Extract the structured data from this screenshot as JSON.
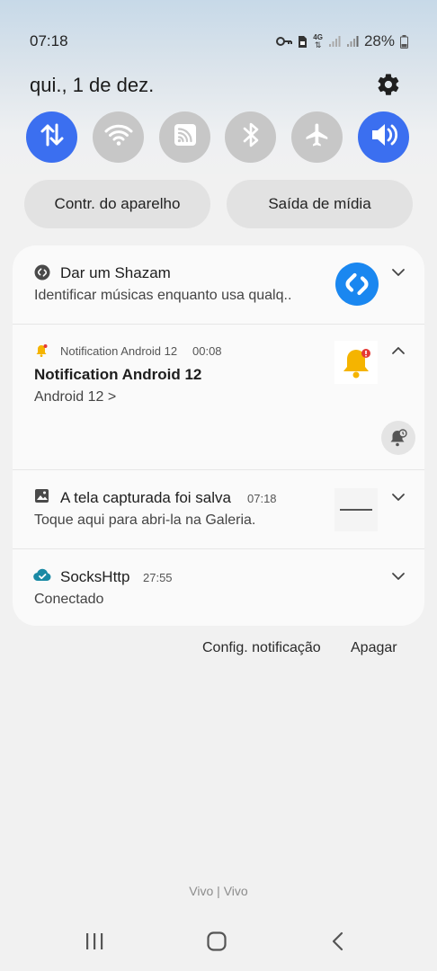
{
  "status_bar": {
    "time": "07:18",
    "network_type": "4G",
    "battery": "28%",
    "icons": [
      "key-icon",
      "sim-card-icon",
      "network-4g-icon",
      "signal-icon",
      "signal-icon",
      "battery-icon"
    ]
  },
  "header": {
    "date": "qui., 1 de dez.",
    "settings_icon": "gear-icon"
  },
  "quick_toggles": [
    {
      "name": "mobile-data",
      "icon": "data-arrows-icon",
      "state": "on"
    },
    {
      "name": "wifi",
      "icon": "wifi-icon",
      "state": "off"
    },
    {
      "name": "cast",
      "icon": "cast-icon",
      "state": "off"
    },
    {
      "name": "bluetooth",
      "icon": "bluetooth-icon",
      "state": "off"
    },
    {
      "name": "airplane-mode",
      "icon": "airplane-icon",
      "state": "off"
    },
    {
      "name": "sound",
      "icon": "volume-icon",
      "state": "on"
    }
  ],
  "device_controls_label": "Contr. do aparelho",
  "media_output_label": "Saída de mídia",
  "notifications": {
    "shazam": {
      "title": "Dar um Shazam",
      "text": "Identificar músicas enquanto usa qualq.."
    },
    "android12": {
      "app": "Notification Android 12",
      "time": "00:08",
      "title": "Notification Android 12",
      "text": "Android 12 >"
    },
    "screenshot": {
      "title": "A tela capturada foi salva",
      "time": "07:18",
      "text": "Toque aqui para abri-la na Galeria."
    },
    "sockshttp": {
      "title": "SocksHttp",
      "time": "27:55",
      "text": "Conectado"
    }
  },
  "footer": {
    "notification_settings": "Config. notificação",
    "clear": "Apagar"
  },
  "carrier": "Vivo | Vivo",
  "colors": {
    "accent": "#3b6ff0",
    "toggle_off": "#c7c7c7",
    "shazam": "#1a87f0",
    "bell": "#f5b400",
    "sockshttp": "#1b8aa5"
  }
}
